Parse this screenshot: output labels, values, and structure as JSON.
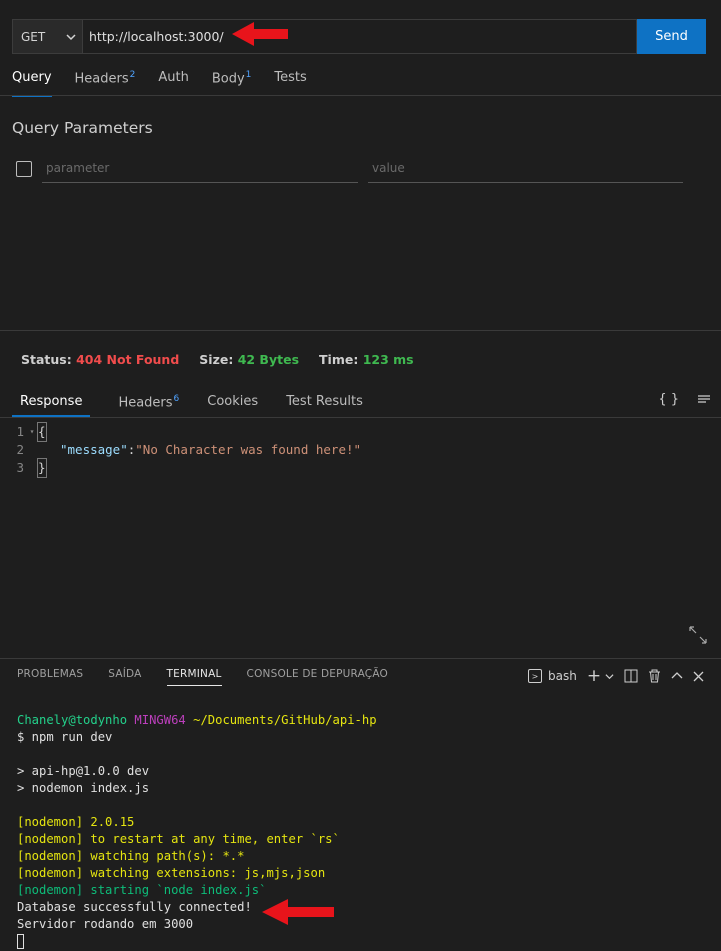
{
  "request": {
    "method": "GET",
    "url": "http://localhost:3000/",
    "send_label": "Send"
  },
  "request_tabs": [
    {
      "label": "Query",
      "badge": ""
    },
    {
      "label": "Headers",
      "badge": "2"
    },
    {
      "label": "Auth",
      "badge": ""
    },
    {
      "label": "Body",
      "badge": "1"
    },
    {
      "label": "Tests",
      "badge": ""
    }
  ],
  "query_params": {
    "title": "Query Parameters",
    "param_placeholder": "parameter",
    "value_placeholder": "value"
  },
  "status": {
    "status_label": "Status:",
    "status_value": "404 Not Found",
    "size_label": "Size:",
    "size_value": "42 Bytes",
    "time_label": "Time:",
    "time_value": "123 ms"
  },
  "response_tabs": [
    {
      "label": "Response",
      "badge": ""
    },
    {
      "label": "Headers",
      "badge": "6"
    },
    {
      "label": "Cookies",
      "badge": ""
    },
    {
      "label": "Test Results",
      "badge": ""
    }
  ],
  "response_icons": {
    "braces": "{ }"
  },
  "response_body": {
    "line1": "{",
    "key": "\"message\"",
    "colon": ": ",
    "value": "\"No Character was found here!\"",
    "line3": "}",
    "line_numbers": [
      "1",
      "2",
      "3"
    ]
  },
  "panel_tabs": [
    "PROBLEMAS",
    "SAÍDA",
    "TERMINAL",
    "CONSOLE DE DEPURAÇÃO"
  ],
  "terminal_shell": "bash",
  "terminal": {
    "user": "Chanely@todynho",
    "env": "MINGW64",
    "path": "~/Documents/GitHub/api-hp",
    "cmd": "$ npm run dev",
    "l1": "> api-hp@1.0.0 dev",
    "l2": "> nodemon index.js",
    "n1": "[nodemon] 2.0.15",
    "n2": "[nodemon] to restart at any time, enter `rs`",
    "n3": "[nodemon] watching path(s): *.*",
    "n4": "[nodemon] watching extensions: js,mjs,json",
    "n5": "[nodemon] starting `node index.js`",
    "o1": "Database successfully connected!",
    "o2": "Servidor rodando em 3000"
  },
  "colors": {
    "accent": "#0e72c4",
    "error": "#f14c4c",
    "success": "#3fb950",
    "annotation_arrow": "#e8141b"
  }
}
